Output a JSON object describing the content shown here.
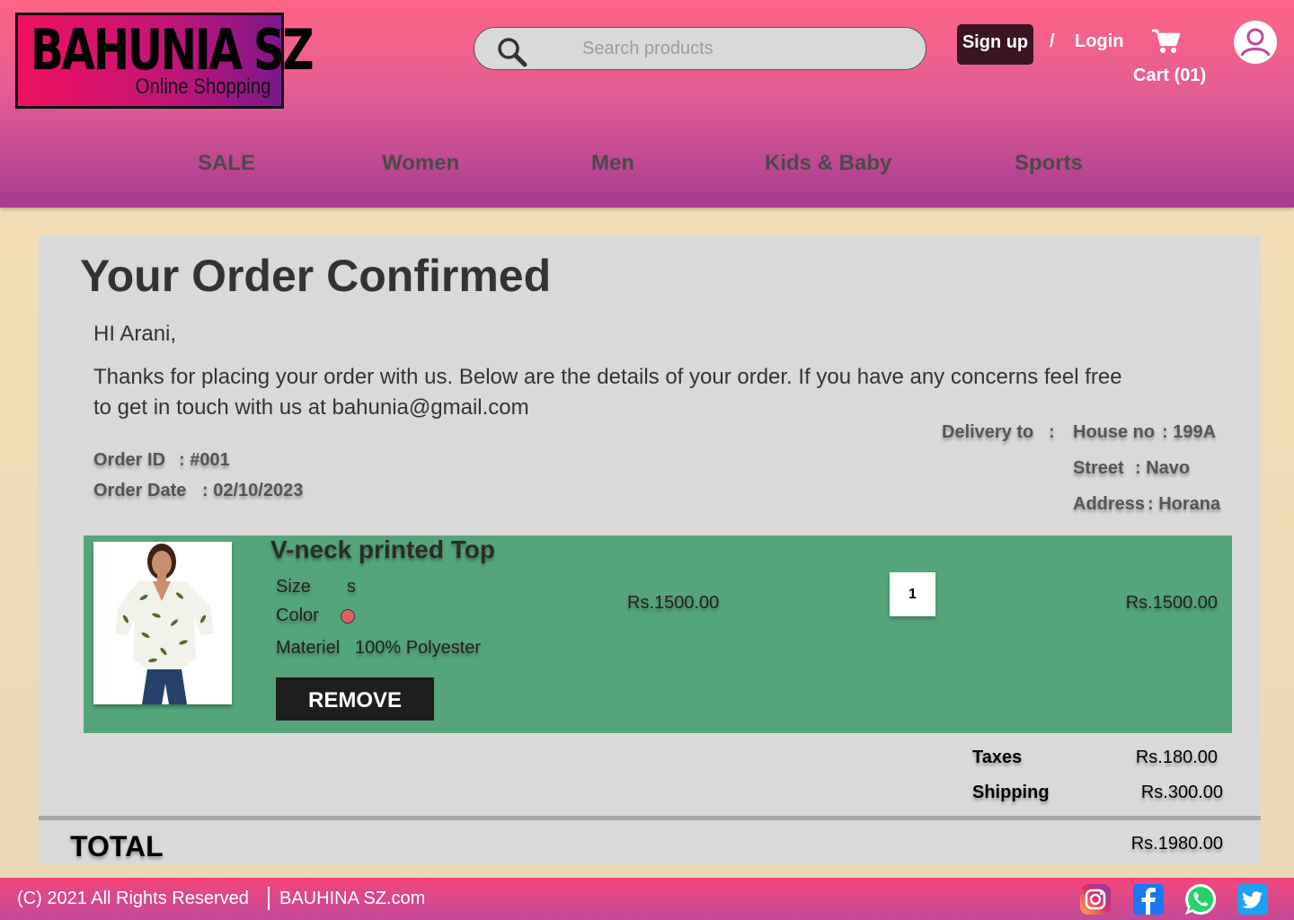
{
  "brand": {
    "title": "BAHUNIA SZ",
    "subtitle": "Online Shopping"
  },
  "search": {
    "placeholder": "Search products",
    "value": ""
  },
  "header": {
    "signup_label": "Sign up",
    "separator": "/",
    "login_label": "Login",
    "cart_label": "Cart (01)"
  },
  "nav": [
    "SALE",
    "Women",
    "Men",
    "Kids & Baby",
    "Sports"
  ],
  "order": {
    "title": "Your Order Confirmed",
    "greeting": "HI Arani,",
    "message": "Thanks for placing your order with us. Below are the details of your order. If you have any concerns feel free to get in touch with us at bahunia@gmail.com",
    "order_id_label": "Order ID",
    "order_id_value": ": #001",
    "order_date_label": "Order Date",
    "order_date_value": ": 02/10/2023",
    "delivery_label": "Delivery to",
    "delivery_colon": ":",
    "house_label": "House no",
    "house_value": ": 199A",
    "street_label": "Street",
    "street_value": ":  Navo",
    "address_label": "Address",
    "address_value": ": Horana"
  },
  "product": {
    "name": "V-neck  printed Top",
    "size_label": "Size",
    "size_value": "s",
    "color_label": "Color",
    "color_value": "#e06060",
    "material_label": "Materiel",
    "material_value": "100% Polyester",
    "remove_label": "REMOVE",
    "unit_price": "Rs.1500.00",
    "quantity": "1",
    "line_total": "Rs.1500.00"
  },
  "summary": {
    "taxes_label": "Taxes",
    "taxes_value": "Rs.180.00",
    "shipping_label": "Shipping",
    "shipping_value": "Rs.300.00",
    "total_label": "TOTAL",
    "total_value": "Rs.1980.00"
  },
  "footer": {
    "copyright": "(C) 2021 All Rights Reserved",
    "site": "BAUHINA SZ.com",
    "social_icons": [
      "instagram-icon",
      "facebook-icon",
      "whatsapp-icon",
      "twitter-icon"
    ]
  }
}
